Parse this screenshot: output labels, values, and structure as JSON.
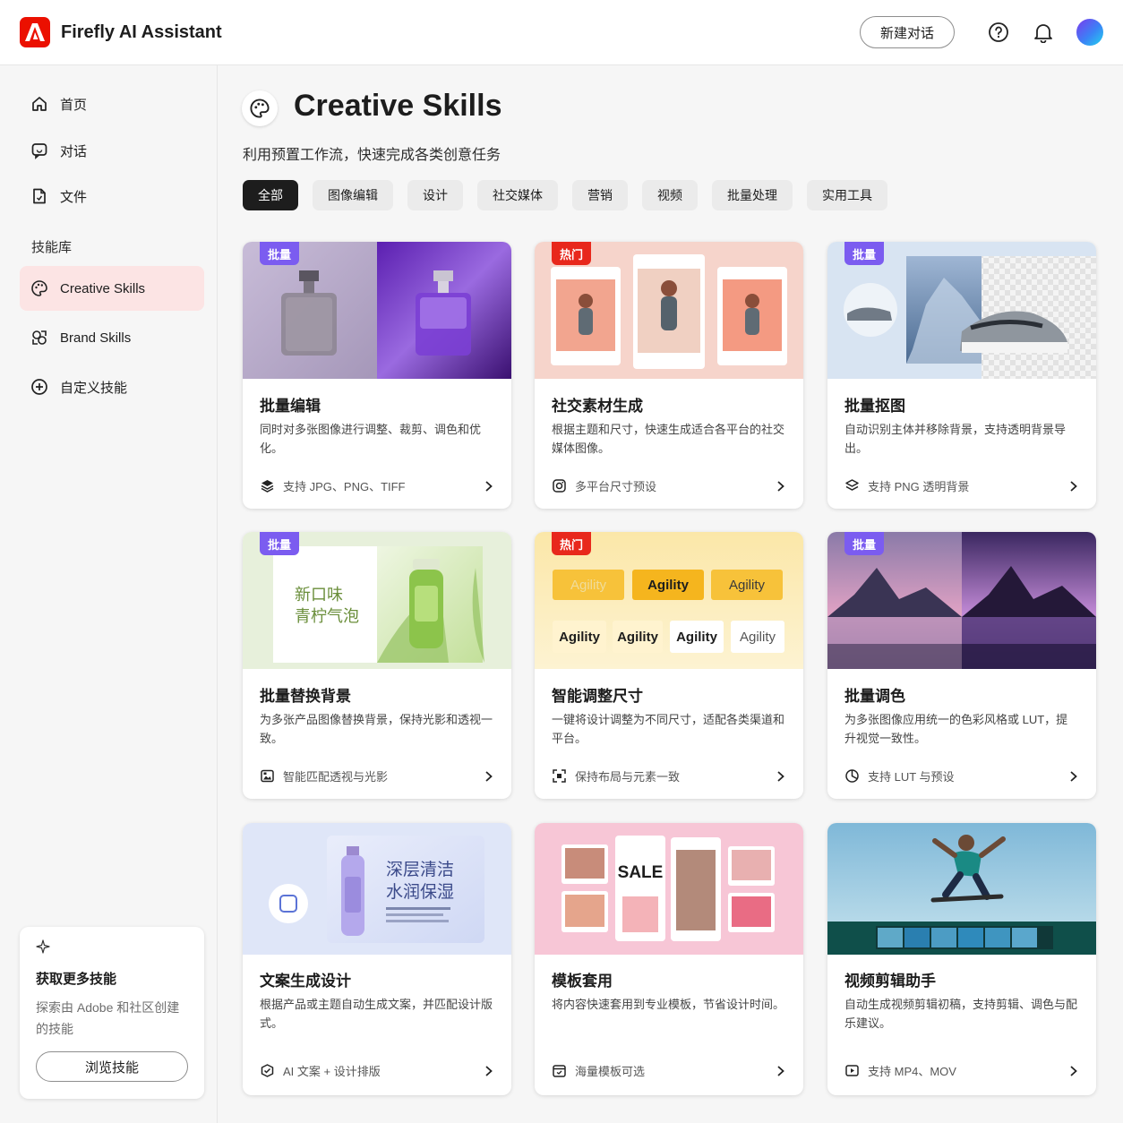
{
  "app": {
    "title": "Firefly AI Assistant"
  },
  "header": {
    "new_chat": "新建对话",
    "help_icon": "help-icon",
    "bell_icon": "bell-icon"
  },
  "sidebar": {
    "items": [
      {
        "label": "首页",
        "icon": "home-icon"
      },
      {
        "label": "对话",
        "icon": "chat-icon"
      },
      {
        "label": "文件",
        "icon": "file-icon"
      }
    ],
    "section_label": "技能库",
    "skills": [
      {
        "label": "Creative Skills",
        "icon": "palette-icon",
        "active": true
      },
      {
        "label": "Brand Skills",
        "icon": "brand-icon"
      },
      {
        "label": "自定义技能",
        "icon": "plus-circle-icon"
      }
    ],
    "promo": {
      "title": "获取更多技能",
      "desc": "探索由 Adobe 和社区创建的技能",
      "button": "浏览技能"
    }
  },
  "main": {
    "title": "Creative Skills",
    "subtitle": "利用预置工作流，快速完成各类创意任务",
    "filters": [
      "全部",
      "图像编辑",
      "设计",
      "社交媒体",
      "营销",
      "视频",
      "批量处理",
      "实用工具"
    ],
    "active_filter": "全部",
    "cards": [
      {
        "badge": "批量",
        "badge_type": "batch",
        "title": "批量编辑",
        "desc": "同时对多张图像进行调整、裁剪、调色和优化。",
        "footer": "支持 JPG、PNG、TIFF",
        "footer_icon": "layers-icon"
      },
      {
        "badge": "热门",
        "badge_type": "hot",
        "title": "社交素材生成",
        "desc": "根据主题和尺寸，快速生成适合各平台的社交媒体图像。",
        "footer": "多平台尺寸预设",
        "footer_icon": "instagram-icon"
      },
      {
        "badge": "批量",
        "badge_type": "batch",
        "title": "批量抠图",
        "desc": "自动识别主体并移除背景，支持透明背景导出。",
        "footer": "支持 PNG 透明背景",
        "footer_icon": "layers-outline-icon"
      },
      {
        "badge": "批量",
        "badge_type": "batch",
        "title": "批量替换背景",
        "desc": "为多张产品图像替换背景，保持光影和透视一致。",
        "footer": "智能匹配透视与光影",
        "footer_icon": "image-frame-icon",
        "thumb_text": [
          "新口味",
          "青柠气泡"
        ]
      },
      {
        "badge": "热门",
        "badge_type": "hot",
        "title": "智能调整尺寸",
        "desc": "一键将设计调整为不同尺寸，适配各类渠道和平台。",
        "footer": "保持布局与元素一致",
        "footer_icon": "resize-icon",
        "thumb_text": [
          "Agility",
          "Agility",
          "Agility",
          "Agility",
          "Agility",
          "Agility",
          "Agility"
        ]
      },
      {
        "badge": "批量",
        "badge_type": "batch",
        "title": "批量调色",
        "desc": "为多张图像应用统一的色彩风格或 LUT，提升视觉一致性。",
        "footer": "支持 LUT 与预设",
        "footer_icon": "color-wheel-icon"
      },
      {
        "badge": "",
        "badge_type": "",
        "title": "文案生成设计",
        "desc": "根据产品或主题自动生成文案，并匹配设计版式。",
        "footer": "AI 文案 + 设计排版",
        "footer_icon": "cube-icon",
        "thumb_text": [
          "深层清洁",
          "水润保湿"
        ]
      },
      {
        "badge": "",
        "badge_type": "",
        "title": "模板套用",
        "desc": "将内容快速套用到专业模板，节省设计时间。",
        "footer": "海量模板可选",
        "footer_icon": "template-icon",
        "thumb_text": [
          "SALE"
        ]
      },
      {
        "badge": "",
        "badge_type": "",
        "title": "视频剪辑助手",
        "desc": "自动生成视频剪辑初稿，支持剪辑、调色与配乐建议。",
        "footer": "支持 MP4、MOV",
        "footer_icon": "video-icon"
      }
    ]
  },
  "colors": {
    "brand": "#eb1000",
    "active_nav": "#fce4e4",
    "batch_badge": "#7b5cf0",
    "hot_badge": "#e8281c"
  }
}
